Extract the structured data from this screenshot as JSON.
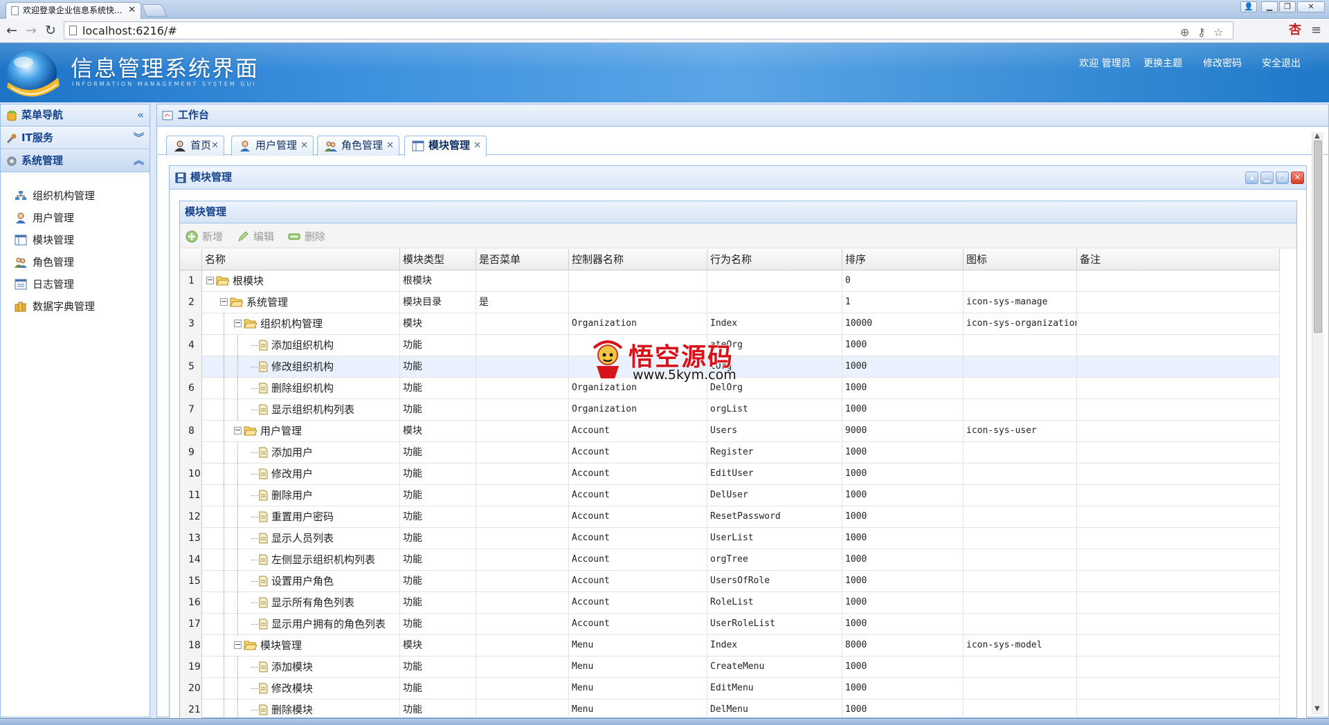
{
  "browser": {
    "tab_title": "欢迎登录企业信息系统快...",
    "url": "localhost:6216/#"
  },
  "header": {
    "title": "信息管理系统界面",
    "subtitle": "INFORMATION MANAGEMENT SYSTEM GUI",
    "links": [
      "欢迎 管理员",
      "更换主题",
      "修改密码",
      "安全退出"
    ]
  },
  "sidebar": {
    "title": "菜单导航",
    "groups": [
      {
        "label": "IT服务",
        "icon": "wrench-icon"
      },
      {
        "label": "系统管理",
        "icon": "gear-icon"
      }
    ],
    "items": [
      {
        "label": "组织机构管理",
        "icon": "org-chart-icon"
      },
      {
        "label": "用户管理",
        "icon": "user-icon"
      },
      {
        "label": "模块管理",
        "icon": "module-icon"
      },
      {
        "label": "角色管理",
        "icon": "role-icon"
      },
      {
        "label": "日志管理",
        "icon": "log-icon"
      },
      {
        "label": "数据字典管理",
        "icon": "dictionary-icon"
      }
    ]
  },
  "workbench": {
    "title": "工作台",
    "tabs": [
      {
        "label": "首页",
        "icon": "home-user-icon"
      },
      {
        "label": "用户管理",
        "icon": "user-icon"
      },
      {
        "label": "角色管理",
        "icon": "role-icon"
      },
      {
        "label": "模块管理",
        "icon": "module-icon",
        "selected": true
      }
    ]
  },
  "module_window": {
    "title": "模块管理",
    "panel_title": "模块管理",
    "toolbar": {
      "add": "新增",
      "edit": "编辑",
      "delete": "删除"
    }
  },
  "grid": {
    "columns": [
      "名称",
      "模块类型",
      "是否菜单",
      "控制器名称",
      "行为名称",
      "排序",
      "图标",
      "备注"
    ],
    "rows": [
      {
        "n": "1",
        "name": "根模块",
        "type": "根模块",
        "menu": "",
        "controller": "",
        "action": "",
        "sort": "0",
        "icon": "",
        "note": "",
        "depth": 0,
        "kind": "folder"
      },
      {
        "n": "2",
        "name": "系统管理",
        "type": "模块目录",
        "menu": "是",
        "controller": "",
        "action": "",
        "sort": "1",
        "icon": "icon-sys-manage",
        "note": "",
        "depth": 1,
        "kind": "folder"
      },
      {
        "n": "3",
        "name": "组织机构管理",
        "type": "模块",
        "menu": "",
        "controller": "Organization",
        "action": "Index",
        "sort": "10000",
        "icon": "icon-sys-organization",
        "note": "",
        "depth": 2,
        "kind": "folder"
      },
      {
        "n": "4",
        "name": "添加组织机构",
        "type": "功能",
        "menu": "",
        "controller": "",
        "action": "ateOrg",
        "sort": "1000",
        "icon": "",
        "note": "",
        "depth": 3,
        "kind": "file"
      },
      {
        "n": "5",
        "name": "修改组织机构",
        "type": "功能",
        "menu": "",
        "controller": "",
        "action": "tOrg",
        "sort": "1000",
        "icon": "",
        "note": "",
        "depth": 3,
        "kind": "file",
        "hl": true
      },
      {
        "n": "6",
        "name": "删除组织机构",
        "type": "功能",
        "menu": "",
        "controller": "Organization",
        "action": "DelOrg",
        "sort": "1000",
        "icon": "",
        "note": "",
        "depth": 3,
        "kind": "file"
      },
      {
        "n": "7",
        "name": "显示组织机构列表",
        "type": "功能",
        "menu": "",
        "controller": "Organization",
        "action": "orgList",
        "sort": "1000",
        "icon": "",
        "note": "",
        "depth": 3,
        "kind": "file"
      },
      {
        "n": "8",
        "name": "用户管理",
        "type": "模块",
        "menu": "",
        "controller": "Account",
        "action": "Users",
        "sort": "9000",
        "icon": "icon-sys-user",
        "note": "",
        "depth": 2,
        "kind": "folder"
      },
      {
        "n": "9",
        "name": "添加用户",
        "type": "功能",
        "menu": "",
        "controller": "Account",
        "action": "Register",
        "sort": "1000",
        "icon": "",
        "note": "",
        "depth": 3,
        "kind": "file"
      },
      {
        "n": "10",
        "name": "修改用户",
        "type": "功能",
        "menu": "",
        "controller": "Account",
        "action": "EditUser",
        "sort": "1000",
        "icon": "",
        "note": "",
        "depth": 3,
        "kind": "file"
      },
      {
        "n": "11",
        "name": "删除用户",
        "type": "功能",
        "menu": "",
        "controller": "Account",
        "action": "DelUser",
        "sort": "1000",
        "icon": "",
        "note": "",
        "depth": 3,
        "kind": "file"
      },
      {
        "n": "12",
        "name": "重置用户密码",
        "type": "功能",
        "menu": "",
        "controller": "Account",
        "action": "ResetPassword",
        "sort": "1000",
        "icon": "",
        "note": "",
        "depth": 3,
        "kind": "file"
      },
      {
        "n": "13",
        "name": "显示人员列表",
        "type": "功能",
        "menu": "",
        "controller": "Account",
        "action": "UserList",
        "sort": "1000",
        "icon": "",
        "note": "",
        "depth": 3,
        "kind": "file"
      },
      {
        "n": "14",
        "name": "左侧显示组织机构列表",
        "type": "功能",
        "menu": "",
        "controller": "Account",
        "action": "orgTree",
        "sort": "1000",
        "icon": "",
        "note": "",
        "depth": 3,
        "kind": "file"
      },
      {
        "n": "15",
        "name": "设置用户角色",
        "type": "功能",
        "menu": "",
        "controller": "Account",
        "action": "UsersOfRole",
        "sort": "1000",
        "icon": "",
        "note": "",
        "depth": 3,
        "kind": "file"
      },
      {
        "n": "16",
        "name": "显示所有角色列表",
        "type": "功能",
        "menu": "",
        "controller": "Account",
        "action": "RoleList",
        "sort": "1000",
        "icon": "",
        "note": "",
        "depth": 3,
        "kind": "file"
      },
      {
        "n": "17",
        "name": "显示用户拥有的角色列表",
        "type": "功能",
        "menu": "",
        "controller": "Account",
        "action": "UserRoleList",
        "sort": "1000",
        "icon": "",
        "note": "",
        "depth": 3,
        "kind": "file"
      },
      {
        "n": "18",
        "name": "模块管理",
        "type": "模块",
        "menu": "",
        "controller": "Menu",
        "action": "Index",
        "sort": "8000",
        "icon": "icon-sys-model",
        "note": "",
        "depth": 2,
        "kind": "folder"
      },
      {
        "n": "19",
        "name": "添加模块",
        "type": "功能",
        "menu": "",
        "controller": "Menu",
        "action": "CreateMenu",
        "sort": "1000",
        "icon": "",
        "note": "",
        "depth": 3,
        "kind": "file"
      },
      {
        "n": "20",
        "name": "修改模块",
        "type": "功能",
        "menu": "",
        "controller": "Menu",
        "action": "EditMenu",
        "sort": "1000",
        "icon": "",
        "note": "",
        "depth": 3,
        "kind": "file"
      },
      {
        "n": "21",
        "name": "删除模块",
        "type": "功能",
        "menu": "",
        "controller": "Menu",
        "action": "DelMenu",
        "sort": "1000",
        "icon": "",
        "note": "",
        "depth": 3,
        "kind": "file"
      }
    ]
  },
  "watermark": {
    "text": "悟空源码",
    "url": "www.5kym.com"
  }
}
